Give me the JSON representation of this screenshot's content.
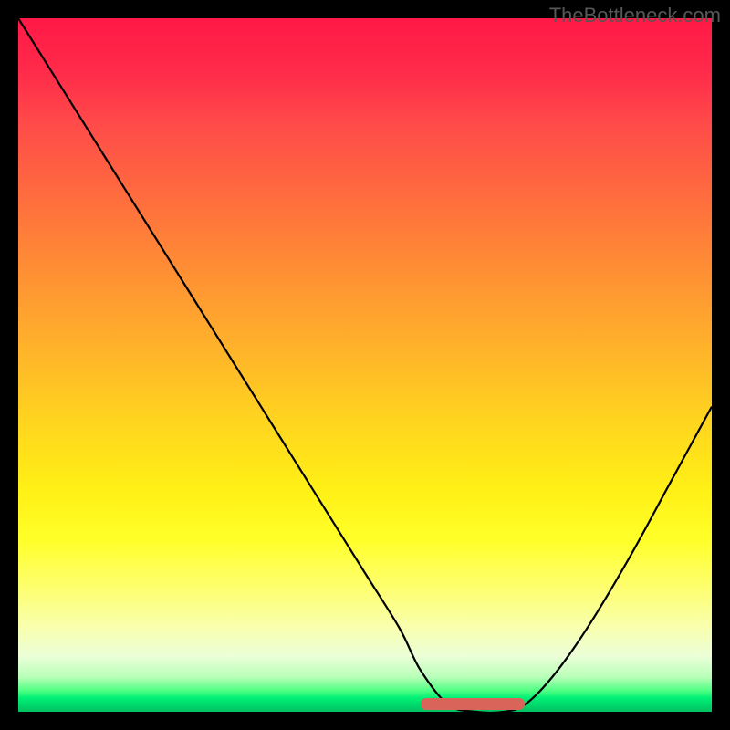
{
  "watermark": "TheBottleneck.com",
  "chart_data": {
    "type": "line",
    "title": "",
    "xlabel": "",
    "ylabel": "",
    "xlim": [
      0,
      100
    ],
    "ylim": [
      0,
      100
    ],
    "background_gradient": {
      "orientation": "vertical",
      "stops": [
        {
          "pos": 0,
          "color": "#ff1846"
        },
        {
          "pos": 50,
          "color": "#ffc820"
        },
        {
          "pos": 80,
          "color": "#ffff60"
        },
        {
          "pos": 100,
          "color": "#00c060"
        }
      ]
    },
    "series": [
      {
        "name": "bottleneck-curve",
        "color": "#000000",
        "x": [
          0,
          5,
          10,
          15,
          20,
          25,
          30,
          35,
          40,
          45,
          50,
          55,
          58,
          62,
          66,
          70,
          73,
          77,
          82,
          88,
          94,
          100
        ],
        "y": [
          100,
          92,
          84,
          76,
          68,
          60,
          52,
          44,
          36,
          28,
          20,
          12,
          6,
          1,
          0,
          0,
          1,
          5,
          12,
          22,
          33,
          44
        ]
      }
    ],
    "annotations": [
      {
        "name": "optimal-range-marker",
        "type": "segment",
        "color": "#d9645a",
        "y": 1.2,
        "x_start": 58,
        "x_end": 73
      }
    ]
  }
}
